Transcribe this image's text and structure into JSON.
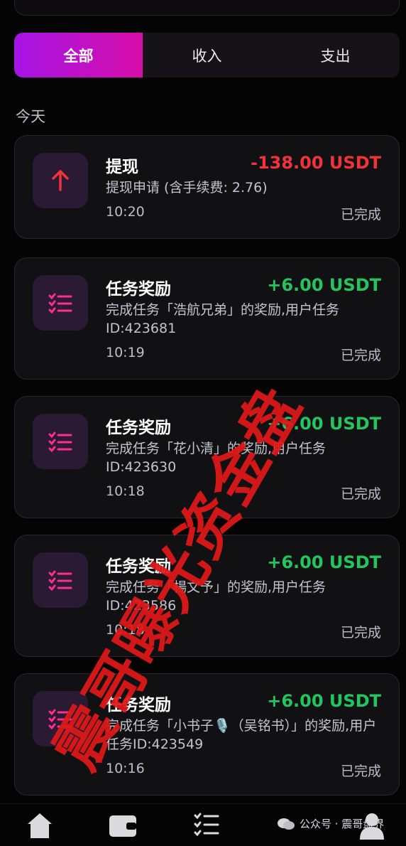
{
  "tabs": [
    {
      "label": "全部",
      "active": true
    },
    {
      "label": "收入",
      "active": false
    },
    {
      "label": "支出",
      "active": false
    }
  ],
  "section_title": "今天",
  "transactions": [
    {
      "title": "提现",
      "amount": "-138.00 USDT",
      "description": "提现申请 (含手续费: 2.76)",
      "time": "10:20",
      "status": "已完成",
      "icon": "arrow-up-icon",
      "amount_color": "#f0333b"
    },
    {
      "title": "任务奖励",
      "amount": "+6.00 USDT",
      "description": "完成任务「浩航兄弟」的奖励,用户任务ID:423681",
      "time": "10:19",
      "status": "已完成",
      "icon": "task-list-icon",
      "amount_color": "#22c55e"
    },
    {
      "title": "任务奖励",
      "amount": "+6.00 USDT",
      "description": "完成任务「花小清」的奖励,用户任务ID:423630",
      "time": "10:18",
      "status": "已完成",
      "icon": "task-list-icon",
      "amount_color": "#22c55e"
    },
    {
      "title": "任务奖励",
      "amount": "+6.00 USDT",
      "description": "完成任务「楊文予」的奖励,用户任务ID:423586",
      "time": "10:18",
      "status": "已完成",
      "icon": "task-list-icon",
      "amount_color": "#22c55e"
    },
    {
      "title": "任务奖励",
      "amount": "+6.00 USDT",
      "description": "完成任务「小书子🎙️（吴铭书）」的奖励,用户任务ID:423549",
      "time": "10:16",
      "status": "已完成",
      "icon": "task-list-icon",
      "amount_color": "#22c55e"
    }
  ],
  "bottom_nav": [
    {
      "icon": "home-icon"
    },
    {
      "icon": "wallet-icon"
    },
    {
      "icon": "task-list-icon"
    },
    {
      "icon": "user-icon"
    }
  ],
  "credit": "公众号 · 震哥盘界",
  "overlay_text": "震哥曝光资金盘",
  "colors": {
    "accent_start": "#a514e6",
    "accent_end": "#d70ea8",
    "negative": "#f0333b",
    "positive": "#22c55e",
    "watermark": "#e01818"
  }
}
